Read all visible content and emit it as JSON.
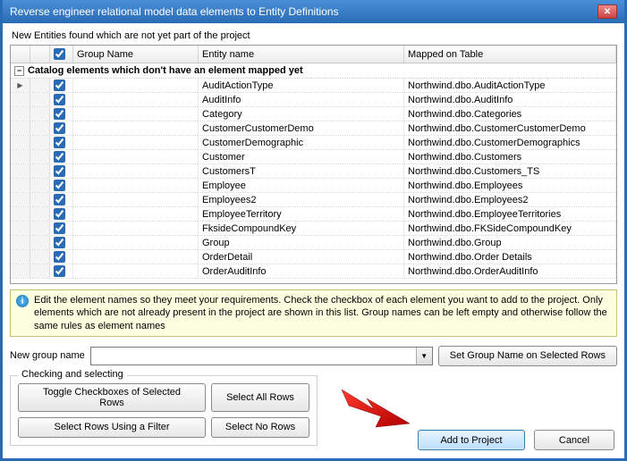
{
  "title": "Reverse engineer relational model data elements to Entity Definitions",
  "subhead": "New Entities found which are not yet part of the project",
  "headers": {
    "group": "Group Name",
    "entity": "Entity name",
    "mapped": "Mapped on Table"
  },
  "groupRowLabel": "Catalog elements which don't have an element mapped yet",
  "rows": [
    {
      "entity": "AuditActionType",
      "mapped": "Northwind.dbo.AuditActionType"
    },
    {
      "entity": "AuditInfo",
      "mapped": "Northwind.dbo.AuditInfo"
    },
    {
      "entity": "Category",
      "mapped": "Northwind.dbo.Categories"
    },
    {
      "entity": "CustomerCustomerDemo",
      "mapped": "Northwind.dbo.CustomerCustomerDemo"
    },
    {
      "entity": "CustomerDemographic",
      "mapped": "Northwind.dbo.CustomerDemographics"
    },
    {
      "entity": "Customer",
      "mapped": "Northwind.dbo.Customers"
    },
    {
      "entity": "CustomersT",
      "mapped": "Northwind.dbo.Customers_TS"
    },
    {
      "entity": "Employee",
      "mapped": "Northwind.dbo.Employees"
    },
    {
      "entity": "Employees2",
      "mapped": "Northwind.dbo.Employees2"
    },
    {
      "entity": "EmployeeTerritory",
      "mapped": "Northwind.dbo.EmployeeTerritories"
    },
    {
      "entity": "FksideCompoundKey",
      "mapped": "Northwind.dbo.FKSideCompoundKey"
    },
    {
      "entity": "Group",
      "mapped": "Northwind.dbo.Group"
    },
    {
      "entity": "OrderDetail",
      "mapped": "Northwind.dbo.Order Details"
    },
    {
      "entity": "OrderAuditInfo",
      "mapped": "Northwind.dbo.OrderAuditInfo"
    }
  ],
  "infoText": "Edit the element names so they meet your requirements. Check the checkbox of each element you want to add to the project. Only elements which are not already present in the project are shown in this list. Group names can be left empty and otherwise follow the same rules as element names",
  "labels": {
    "newGroupName": "New group name",
    "setGroupName": "Set Group Name on Selected Rows",
    "checkingSelecting": "Checking and selecting",
    "toggleCheckboxes": "Toggle Checkboxes of Selected Rows",
    "selectAllRows": "Select All Rows",
    "selectUsingFilter": "Select Rows Using a Filter",
    "selectNoRows": "Select No Rows",
    "addToProject": "Add to Project",
    "cancel": "Cancel"
  }
}
